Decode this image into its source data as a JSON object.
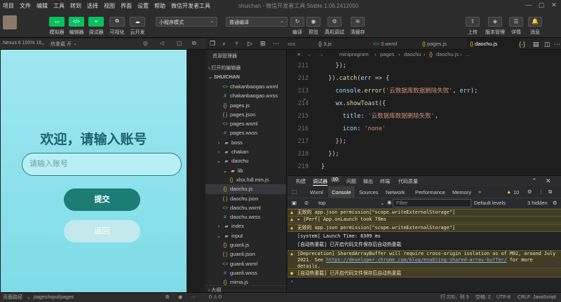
{
  "menu": [
    "项目",
    "文件",
    "编辑",
    "工具",
    "转到",
    "选择",
    "视图",
    "界面",
    "设置",
    "帮助",
    "微信开发者工具"
  ],
  "window_title": "shuichan - 微信开发者工具 Stable 1.06.2412050",
  "toolbar": {
    "simulator": "模拟器",
    "editor": "编辑器",
    "debugger": "调试器",
    "visual": "可视化",
    "cloud": "云开发",
    "mode": "小程序模式",
    "compile_mode": "普通编译",
    "compile": "编译",
    "preview": "预览",
    "real_debug": "真机调试",
    "clear_cache": "清缓存",
    "upload": "上传",
    "version": "版本管理",
    "details": "详情",
    "messages": "消息"
  },
  "simulator": {
    "device": "Nexus 6 100% 16",
    "hotreload": "热重载 开",
    "welcome": "欢迎，请输入账号",
    "placeholder": "请输入账号",
    "submit": "提交",
    "back": "返回"
  },
  "explorer": {
    "title": "资源管理器",
    "open_editors": "打开的编辑器",
    "project": "SHUICHAN",
    "items": [
      {
        "indent": 2,
        "icon": "wxml",
        "label": "chakanbaogao.wxml"
      },
      {
        "indent": 2,
        "icon": "wxss",
        "label": "chakanbaogao.wxss"
      },
      {
        "indent": 2,
        "icon": "js",
        "label": "pages.js"
      },
      {
        "indent": 2,
        "icon": "json",
        "label": "pages.json"
      },
      {
        "indent": 2,
        "icon": "wxml",
        "label": "pages.wxml"
      },
      {
        "indent": 2,
        "icon": "wxss",
        "label": "pages.wxss"
      },
      {
        "indent": 1,
        "icon": "folder-closed",
        "label": "boss"
      },
      {
        "indent": 1,
        "icon": "folder-closed",
        "label": "chakan"
      },
      {
        "indent": 1,
        "icon": "folder-open",
        "label": "daochu"
      },
      {
        "indent": 2,
        "icon": "folder-open",
        "label": "lib"
      },
      {
        "indent": 3,
        "icon": "js",
        "label": "xlsx.full.min.js"
      },
      {
        "indent": 2,
        "icon": "js",
        "label": "daochu.js",
        "selected": true
      },
      {
        "indent": 2,
        "icon": "json",
        "label": "daochu.json"
      },
      {
        "indent": 2,
        "icon": "wxml",
        "label": "daochu.wxml"
      },
      {
        "indent": 2,
        "icon": "wxss",
        "label": "daochu.wxss"
      },
      {
        "indent": 1,
        "icon": "folder-closed",
        "label": "index"
      },
      {
        "indent": 1,
        "icon": "folder-open",
        "label": "input"
      },
      {
        "indent": 2,
        "icon": "js",
        "label": "guanli.js"
      },
      {
        "indent": 2,
        "icon": "json",
        "label": "guanli.json"
      },
      {
        "indent": 2,
        "icon": "wxml",
        "label": "guanli.wxml"
      },
      {
        "indent": 2,
        "icon": "wxss",
        "label": "guanli.wxss"
      },
      {
        "indent": 2,
        "icon": "js",
        "label": "mima.js"
      }
    ],
    "outline": "大纲"
  },
  "editor": {
    "tabs": [
      "3.js",
      "3.wxml",
      "pages.js",
      "daochu.js"
    ],
    "breadcrumb": [
      "miniprogram",
      "pages",
      "daochu",
      "daochu.js",
      "..."
    ],
    "lines": [
      {
        "n": "211",
        "text": "    });"
      },
      {
        "n": "212",
        "text": "  }).catch(err => {"
      },
      {
        "n": "213",
        "text": "    console.error('云数据库数据删除失败', err);"
      },
      {
        "n": "214",
        "text": "    wx.showToast({"
      },
      {
        "n": "215",
        "text": "      title: '云数据库数据删除失败',"
      },
      {
        "n": "216",
        "text": "      icon: 'none'"
      },
      {
        "n": "217",
        "text": "    });"
      },
      {
        "n": "218",
        "text": "  });"
      },
      {
        "n": "219",
        "text": "}"
      }
    ]
  },
  "devtools": {
    "tabs": [
      "构建",
      "调试器",
      "10",
      "问题",
      "输出",
      "终端",
      "代码质量"
    ],
    "subtabs": [
      "Wxml",
      "Console",
      "Sources",
      "Network",
      "Performance",
      "Memory"
    ],
    "warn_count": "10",
    "context": "top",
    "filter_placeholder": "Filter",
    "levels": "Default levels",
    "hidden": "3 hidden",
    "messages": [
      {
        "type": "warn",
        "text": "无效的 app.json permission[\"scope.writeExternalStorage\"]"
      },
      {
        "type": "warn",
        "text": "[Perf] App.onLaunch took 79ms"
      },
      {
        "type": "warn",
        "text": "无效的 app.json permission[\"scope.writeExternalStorage\"]"
      },
      {
        "type": "info",
        "text": "[system] Launch Time: 8309 ms"
      },
      {
        "type": "info",
        "text": "[自动热重载] 已开启代码文件保存后自动热重载"
      },
      {
        "type": "warn",
        "text": "[Deprecation] SharedArrayBuffer will require cross-origin isolation as of M92, around July 2021. See ",
        "link": "https://developer.chrome.com/blog/enabling-shared-array-buffer/",
        "after": " for more details."
      },
      {
        "type": "warn",
        "text": "[自动热重载] 已开启代码文件保存后自动热重载"
      }
    ]
  },
  "status": {
    "left": "页面路径",
    "path": "pages/input/pages",
    "problems": "0 ⚠ 0",
    "position": "行 220，列 3",
    "spaces": "空格: 2",
    "encoding": "UTF-8",
    "eol": "CRLF",
    "language": "JavaScript"
  },
  "colors": {
    "accent_green": "#07c160",
    "phone_bg": "#8fe1ec",
    "submit": "#1b7d76",
    "title": "#1d5f6a"
  }
}
